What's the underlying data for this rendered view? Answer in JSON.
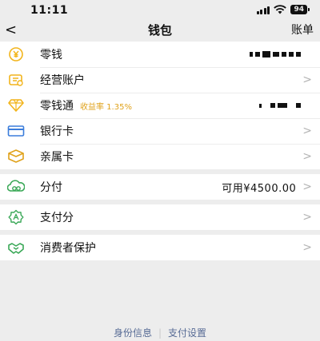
{
  "status_bar": {
    "time": "11:11",
    "battery": "94"
  },
  "nav": {
    "back": "<",
    "title": "钱包",
    "right": "账单"
  },
  "items": [
    {
      "label": "零钱",
      "icon": "coin-icon",
      "accent": "#f2b41b"
    },
    {
      "label": "经营账户",
      "icon": "business-account-icon",
      "accent": "#f2b41b"
    },
    {
      "label": "零钱通",
      "badge": "收益率 1.35%",
      "icon": "diamond-icon",
      "accent": "#f2b41b"
    },
    {
      "label": "银行卡",
      "icon": "bank-card-icon",
      "accent": "#3b7ddb"
    },
    {
      "label": "亲属卡",
      "icon": "family-card-icon",
      "accent": "#e0a21b"
    },
    {
      "label": "分付",
      "value": "可用¥4500.00",
      "icon": "fenfu-icon",
      "accent": "#3aa857"
    },
    {
      "label": "支付分",
      "icon": "pay-score-icon",
      "accent": "#3aa857"
    },
    {
      "label": "消费者保护",
      "icon": "consumer-protection-icon",
      "accent": "#3aa857"
    }
  ],
  "footer": {
    "identity": "身份信息",
    "separator": "|",
    "settings": "支付设置"
  },
  "colors": {
    "background": "#ededed",
    "link": "#576b95",
    "yellow": "#f2b41b",
    "green": "#3aa857",
    "blue": "#3b7ddb"
  }
}
